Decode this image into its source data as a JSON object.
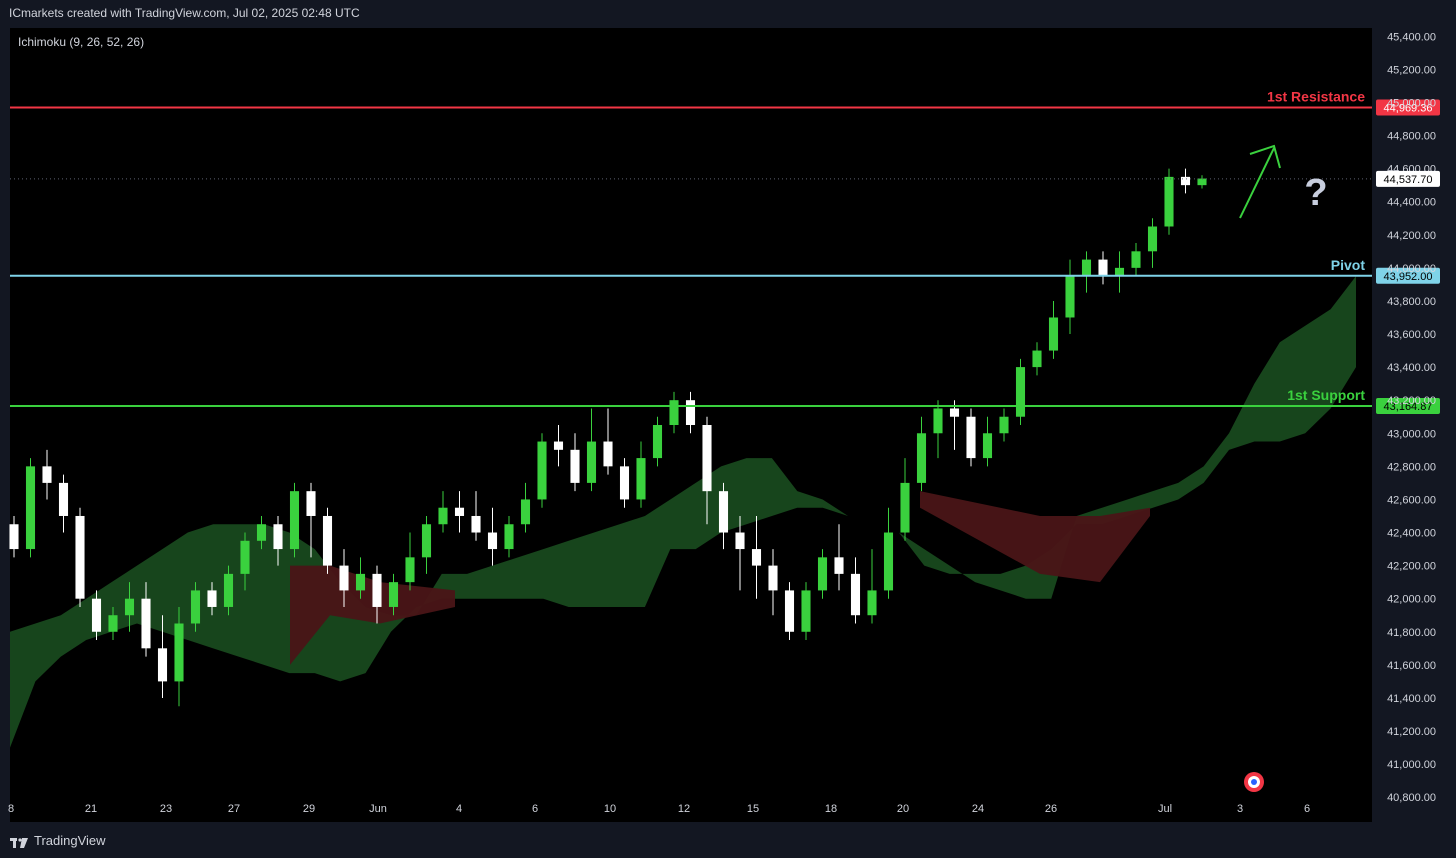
{
  "header": {
    "attribution": "ICmarkets created with TradingView.com, Jul 02, 2025 02:48 UTC"
  },
  "indicator": {
    "label": "Ichimoku (9, 26, 52, 26)"
  },
  "footer": {
    "brand": "TradingView"
  },
  "colors": {
    "bg": "#000000",
    "up": "#3ad13e",
    "down": "#ffffff",
    "cloud_bull": "#1a4d1f",
    "cloud_bear": "#4a1517",
    "resistance": "#f23645",
    "pivot": "#7fd3e9",
    "support": "#3ad13e",
    "text": "#d1d4dc"
  },
  "chart_data": {
    "type": "candlestick",
    "y_axis": {
      "ticks": [
        "45,400.00",
        "45,200.00",
        "45,000.00",
        "44,800.00",
        "44,600.00",
        "44,400.00",
        "44,200.00",
        "44,000.00",
        "43,800.00",
        "43,600.00",
        "43,400.00",
        "43,200.00",
        "43,000.00",
        "42,800.00",
        "42,600.00",
        "42,400.00",
        "42,200.00",
        "42,000.00",
        "41,800.00",
        "41,600.00",
        "41,400.00",
        "41,200.00",
        "41,000.00",
        "40,800.00"
      ],
      "range": [
        40650,
        45450
      ]
    },
    "x_axis": {
      "ticks": [
        "8",
        "21",
        "23",
        "27",
        "29",
        "Jun",
        "4",
        "6",
        "10",
        "12",
        "15",
        "18",
        "20",
        "24",
        "26",
        "Jul",
        "3",
        "6"
      ]
    },
    "levels": [
      {
        "name": "1st Resistance",
        "value": 44969.36,
        "label": "44,969.36",
        "color": "#f23645"
      },
      {
        "name": "Pivot",
        "value": 43952.0,
        "label": "43,952.00",
        "color": "#7fd3e9"
      },
      {
        "name": "1st Support",
        "value": 43164.87,
        "label": "43,164.87",
        "color": "#3ad13e"
      }
    ],
    "last_price": {
      "value": 44537.7,
      "label": "44,537.70"
    },
    "annotation": {
      "arrow": "up",
      "symbol": "?"
    },
    "cloud_bull_top": [
      41800,
      41850,
      41900,
      42000,
      42100,
      42200,
      42300,
      42400,
      42450,
      42450,
      42450,
      42400,
      42300,
      42100,
      41950,
      41900,
      41900,
      42150,
      42150,
      42200,
      42250,
      42300,
      42350,
      42400,
      42450,
      42500,
      42600,
      42700,
      42800,
      42850,
      42850,
      42650,
      42600,
      42500,
      42450,
      42400,
      42300,
      42200,
      42100,
      42050,
      42000,
      42000,
      42500,
      42550,
      42600,
      42650,
      42700,
      42800,
      43000,
      43300,
      43550,
      43650,
      43750,
      43950
    ],
    "cloud_bull_bot": [
      41100,
      41500,
      41650,
      41750,
      41800,
      41850,
      41800,
      41750,
      41700,
      41650,
      41600,
      41550,
      41550,
      41500,
      41550,
      41800,
      41950,
      42000,
      42000,
      42000,
      42000,
      42000,
      41950,
      41950,
      41950,
      41950,
      42300,
      42300,
      42400,
      42450,
      42500,
      42550,
      42550,
      42500,
      42450,
      42400,
      42200,
      42150,
      42150,
      42150,
      42200,
      42300,
      42450,
      42450,
      42500,
      42550,
      42600,
      42700,
      42900,
      42950,
      42950,
      43000,
      43150,
      43400
    ],
    "candles": [
      [
        42450,
        42300,
        42500,
        42250
      ],
      [
        42300,
        42800,
        42850,
        42250
      ],
      [
        42800,
        42700,
        42900,
        42600
      ],
      [
        42700,
        42500,
        42750,
        42400
      ],
      [
        42500,
        42000,
        42550,
        41950
      ],
      [
        42000,
        41800,
        42050,
        41750
      ],
      [
        41800,
        41900,
        41950,
        41750
      ],
      [
        41900,
        42000,
        42100,
        41800
      ],
      [
        42000,
        41700,
        42100,
        41650
      ],
      [
        41700,
        41500,
        41900,
        41400
      ],
      [
        41500,
        41850,
        41950,
        41350
      ],
      [
        41850,
        42050,
        42100,
        41800
      ],
      [
        42050,
        41950,
        42100,
        41900
      ],
      [
        41950,
        42150,
        42200,
        41900
      ],
      [
        42150,
        42350,
        42400,
        42050
      ],
      [
        42350,
        42450,
        42500,
        42300
      ],
      [
        42450,
        42300,
        42500,
        42200
      ],
      [
        42300,
        42650,
        42700,
        42250
      ],
      [
        42650,
        42500,
        42700,
        42250
      ],
      [
        42500,
        42200,
        42550,
        42150
      ],
      [
        42200,
        42050,
        42300,
        41950
      ],
      [
        42050,
        42150,
        42250,
        42000
      ],
      [
        42150,
        41950,
        42200,
        41850
      ],
      [
        41950,
        42100,
        42150,
        41900
      ],
      [
        42100,
        42250,
        42400,
        42050
      ],
      [
        42250,
        42450,
        42500,
        42150
      ],
      [
        42450,
        42550,
        42650,
        42400
      ],
      [
        42550,
        42500,
        42650,
        42400
      ],
      [
        42500,
        42400,
        42650,
        42350
      ],
      [
        42400,
        42300,
        42550,
        42200
      ],
      [
        42300,
        42450,
        42500,
        42250
      ],
      [
        42450,
        42600,
        42700,
        42400
      ],
      [
        42600,
        42950,
        43000,
        42550
      ],
      [
        42950,
        42900,
        43050,
        42800
      ],
      [
        42900,
        42700,
        43000,
        42650
      ],
      [
        42700,
        42950,
        43150,
        42650
      ],
      [
        42950,
        42800,
        43150,
        42750
      ],
      [
        42800,
        42600,
        42850,
        42550
      ],
      [
        42600,
        42850,
        42950,
        42550
      ],
      [
        42850,
        43050,
        43100,
        42800
      ],
      [
        43050,
        43200,
        43250,
        43000
      ],
      [
        43200,
        43050,
        43250,
        43000
      ],
      [
        43050,
        42650,
        43100,
        42450
      ],
      [
        42650,
        42400,
        42700,
        42300
      ],
      [
        42400,
        42300,
        42500,
        42050
      ],
      [
        42300,
        42200,
        42500,
        42000
      ],
      [
        42200,
        42050,
        42300,
        41900
      ],
      [
        42050,
        41800,
        42100,
        41750
      ],
      [
        41800,
        42050,
        42100,
        41750
      ],
      [
        42050,
        42250,
        42300,
        42000
      ],
      [
        42250,
        42150,
        42450,
        42050
      ],
      [
        42150,
        41900,
        42250,
        41850
      ],
      [
        41900,
        42050,
        42300,
        41850
      ],
      [
        42050,
        42400,
        42550,
        42000
      ],
      [
        42400,
        42700,
        42850,
        42350
      ],
      [
        42700,
        43000,
        43100,
        42650
      ],
      [
        43000,
        43150,
        43200,
        42850
      ],
      [
        43150,
        43100,
        43200,
        42900
      ],
      [
        43100,
        42850,
        43150,
        42800
      ],
      [
        42850,
        43000,
        43100,
        42800
      ],
      [
        43000,
        43100,
        43150,
        42950
      ],
      [
        43100,
        43400,
        43450,
        43050
      ],
      [
        43400,
        43500,
        43550,
        43350
      ],
      [
        43500,
        43700,
        43800,
        43450
      ],
      [
        43700,
        43950,
        44050,
        43600
      ],
      [
        43950,
        44050,
        44100,
        43850
      ],
      [
        44050,
        43950,
        44100,
        43900
      ],
      [
        43950,
        44000,
        44100,
        43850
      ],
      [
        44000,
        44100,
        44150,
        43950
      ],
      [
        44100,
        44250,
        44300,
        44000
      ],
      [
        44250,
        44550,
        44600,
        44200
      ],
      [
        44550,
        44500,
        44600,
        44450
      ],
      [
        44500,
        44540,
        44560,
        44480
      ]
    ]
  }
}
